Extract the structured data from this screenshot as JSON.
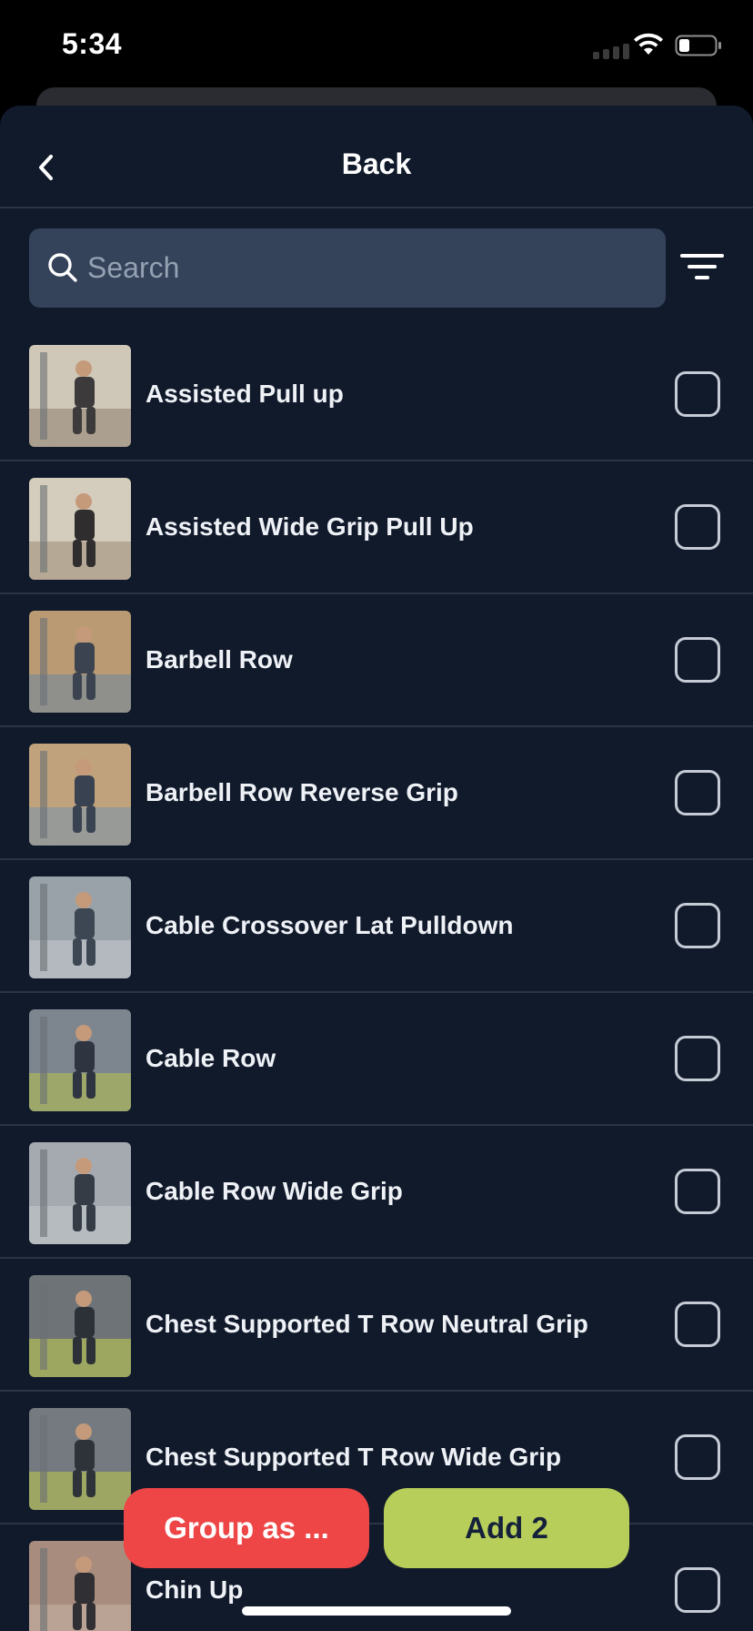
{
  "status_bar": {
    "time": "5:34"
  },
  "header": {
    "title": "Back"
  },
  "search": {
    "placeholder": "Search",
    "value": ""
  },
  "colors": {
    "background": "#111a2b",
    "search_field": "#34435a",
    "group_button": "#ee4546",
    "add_button": "#b7ce5a",
    "divider": "#2a3446"
  },
  "exercises": [
    {
      "name": "Assisted Pull up",
      "checked": false,
      "thumb": "gym-photo"
    },
    {
      "name": "Assisted Wide Grip Pull Up",
      "checked": false,
      "thumb": "gym-photo"
    },
    {
      "name": "Barbell Row",
      "checked": false,
      "thumb": "gym-photo"
    },
    {
      "name": "Barbell Row Reverse Grip",
      "checked": false,
      "thumb": "gym-photo"
    },
    {
      "name": "Cable Crossover Lat Pulldown",
      "checked": false,
      "thumb": "gym-photo"
    },
    {
      "name": "Cable Row",
      "checked": false,
      "thumb": "gym-photo"
    },
    {
      "name": "Cable Row Wide Grip",
      "checked": false,
      "thumb": "gym-photo"
    },
    {
      "name": "Chest Supported T Row Neutral Grip",
      "checked": false,
      "thumb": "gym-photo"
    },
    {
      "name": "Chest Supported T Row Wide Grip",
      "checked": false,
      "thumb": "gym-photo"
    },
    {
      "name": "Chin Up",
      "checked": false,
      "thumb": "gym-photo"
    }
  ],
  "actions": {
    "group_label": "Group as ...",
    "add_label": "Add 2"
  }
}
